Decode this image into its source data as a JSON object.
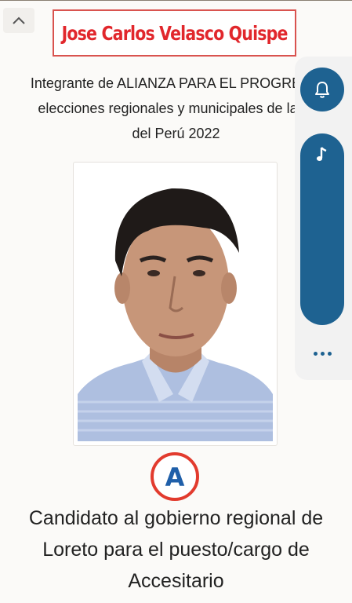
{
  "header": {
    "candidate_name": "Jose Carlos Velasco Quispe"
  },
  "description": {
    "line1": "Integrante de ALIANZA PARA EL PROGRESO",
    "line2": "elecciones regionales y municipales de la re",
    "line3": "del Perú 2022"
  },
  "party_logo": {
    "letter": "A"
  },
  "candidacy": {
    "line1": "Candidato al gobierno regional de",
    "line2": "Loreto para el puesto/cargo de",
    "line3": "Accesitario"
  },
  "icons": {
    "collapse": "chevron-up-icon",
    "notifications": "bell-icon",
    "music": "music-note-icon",
    "more": "more-horizontal-icon"
  },
  "colors": {
    "title_red": "#e1272c",
    "side_blue": "#1e6291",
    "logo_blue": "#1f5fa9",
    "logo_red": "#e23b2e"
  }
}
